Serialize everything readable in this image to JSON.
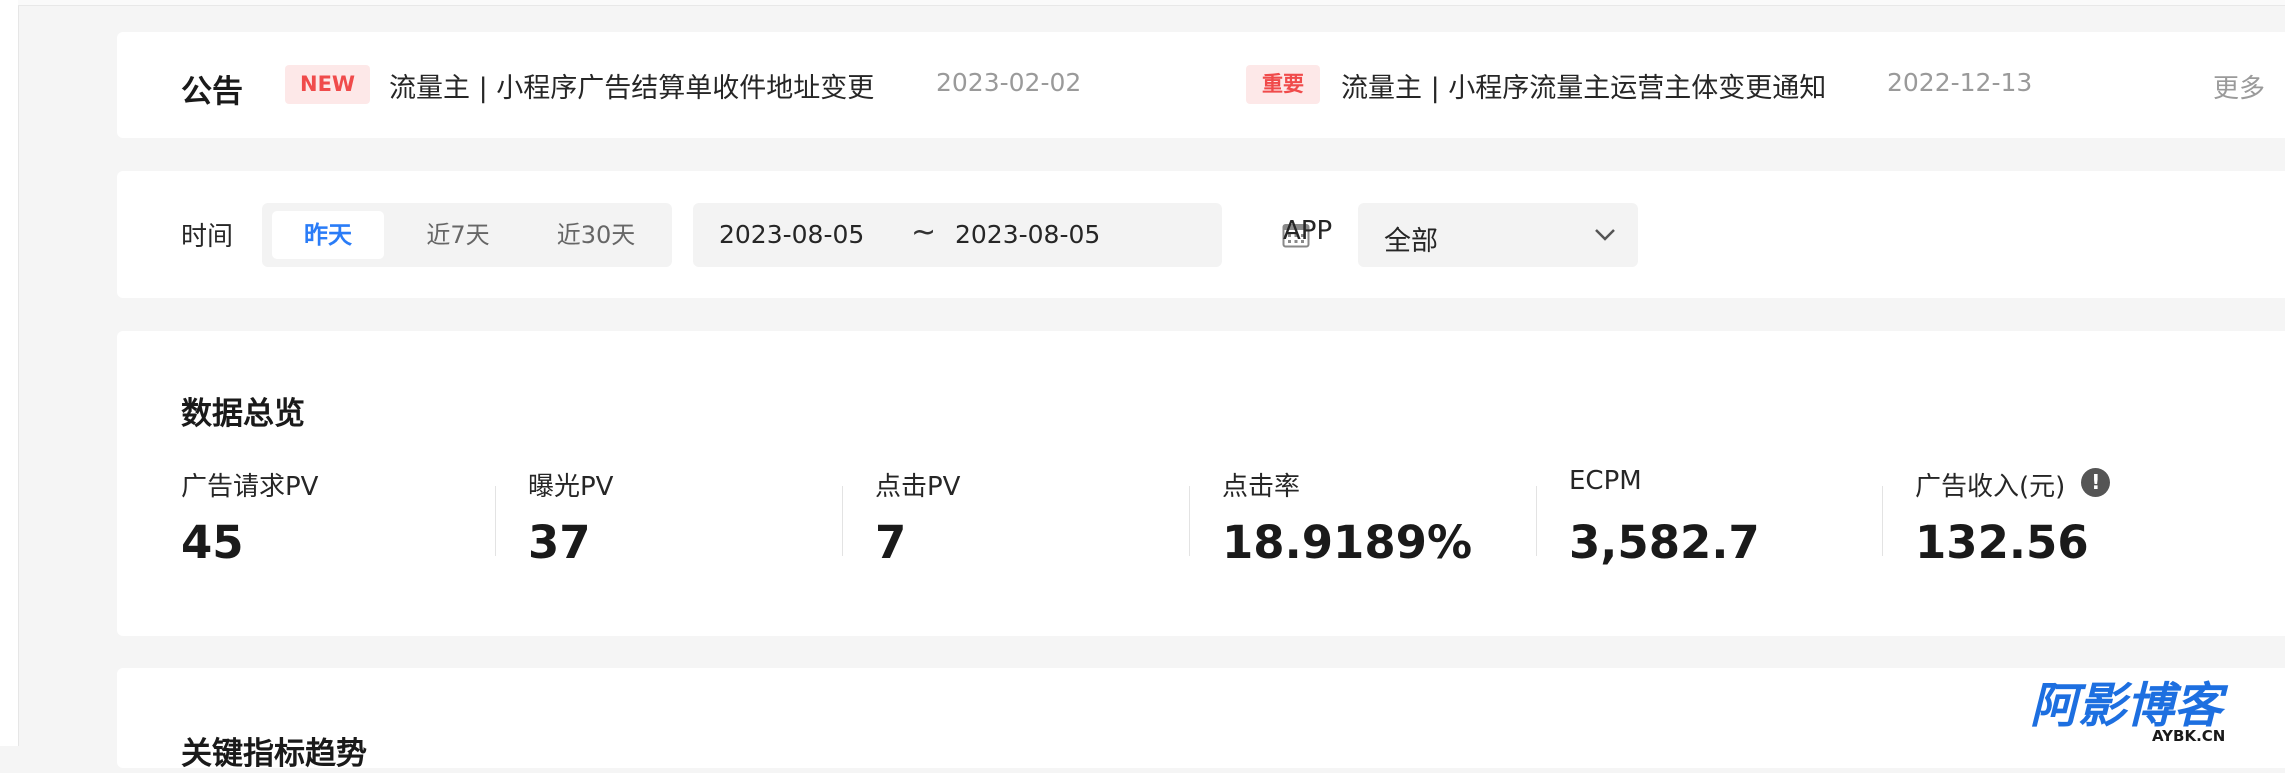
{
  "announcement": {
    "title": "公告",
    "items": [
      {
        "tag": "NEW",
        "text": "流量主 | 小程序广告结算单收件地址变更",
        "date": "2023-02-02"
      },
      {
        "tag": "重要",
        "text": "流量主 | 小程序流量主运营主体变更通知",
        "date": "2022-12-13"
      }
    ],
    "more": "更多"
  },
  "filters": {
    "time_label": "时间",
    "ranges": [
      "昨天",
      "近7天",
      "近30天"
    ],
    "active_range": "昨天",
    "start_date": "2023-08-05",
    "separator": "~",
    "end_date": "2023-08-05",
    "app_label": "APP",
    "app_value": "全部"
  },
  "overview": {
    "title": "数据总览",
    "metrics": [
      {
        "label": "广告请求PV",
        "value": "45"
      },
      {
        "label": "曝光PV",
        "value": "37"
      },
      {
        "label": "点击PV",
        "value": "7"
      },
      {
        "label": "点击率",
        "value": "18.9189%"
      },
      {
        "label": "ECPM",
        "value": "3,582.7"
      },
      {
        "label": "广告收入(元)",
        "value": "132.56"
      }
    ]
  },
  "trend": {
    "title": "关键指标趋势"
  },
  "watermark": {
    "main": "阿影博客",
    "sub": "AYBK.CN"
  },
  "colors": {
    "accent": "#2a7cf7",
    "tag_red": "#f04b4b",
    "tag_bg": "#fde8e8"
  }
}
